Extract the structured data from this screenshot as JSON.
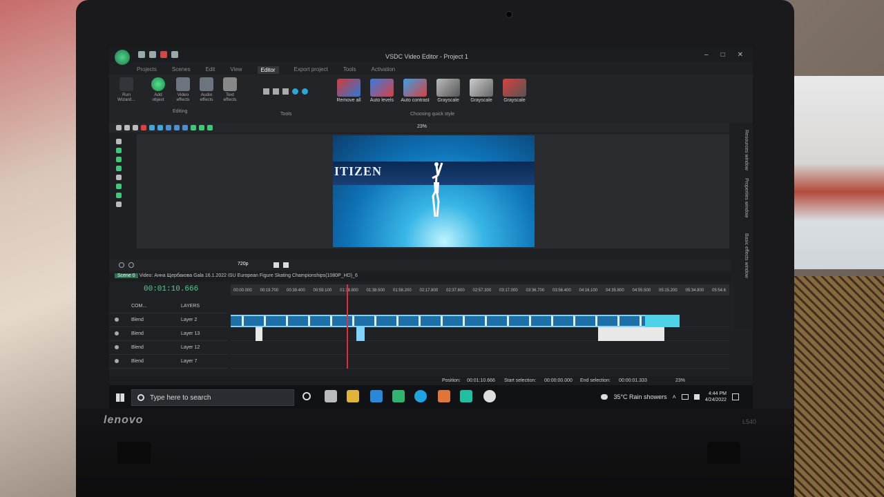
{
  "window": {
    "title": "VSDC Video Editor - Project 1",
    "controls": [
      "–",
      "□",
      "✕"
    ]
  },
  "menu": {
    "items": [
      "Projects",
      "Scenes",
      "Edit",
      "View",
      "Editor",
      "Export project",
      "Tools",
      "Activation"
    ],
    "active": "Editor"
  },
  "ribbon": {
    "groups": [
      {
        "label": "Run Wizard...",
        "icon": "wand-icon"
      },
      {
        "label": "Add object",
        "icon": "add-object-icon"
      },
      {
        "label": "Video effects",
        "icon": "video-effects-icon"
      },
      {
        "label": "Audio effects",
        "icon": "audio-effects-icon"
      },
      {
        "label": "Text effects",
        "icon": "text-effects-icon"
      }
    ],
    "editing_caption": "Editing",
    "tools_caption": "Tools",
    "quick_style_caption": "Choosing quick style",
    "quick_styles": [
      {
        "label": "Remove all",
        "color": "#d23a3a"
      },
      {
        "label": "Auto levels",
        "color": "#3a7be0"
      },
      {
        "label": "Auto contrast",
        "color": "#3aa0e0"
      },
      {
        "label": "Grayscale",
        "color": "#8a8a8a"
      },
      {
        "label": "Grayscale",
        "color": "#9a9a9a"
      },
      {
        "label": "Grayscale",
        "color": "#7a7a7a"
      }
    ]
  },
  "toolbar": {
    "zoom": "23%"
  },
  "preview": {
    "board_text": "ITIZEN"
  },
  "side_tabs": [
    "Resources window",
    "Properties window",
    "Basic effects window"
  ],
  "timeline_toolbar": {
    "resolution": "720p"
  },
  "file_tab": {
    "scene": "Scene 0",
    "title": "Video: Анна Щербакова Gala 16.1.2022 ISU European Figure Skating Championships(1080P_HD)_6"
  },
  "timeline": {
    "current_time": "00:01:10.666",
    "ruler": [
      "00:00.000",
      "00:19.700",
      "00:39.400",
      "00:59.100",
      "01:18.800",
      "01:38.500",
      "01:58.200",
      "02:17.800",
      "02:37.600",
      "02:57.300",
      "03:17.000",
      "03:36.700",
      "03:56.400",
      "04:16.100",
      "04:35.800",
      "04:55.500",
      "05:15.200",
      "05:34.800",
      "05:54.6"
    ],
    "header": {
      "com": "COM...",
      "layers": "LAYERS"
    },
    "tracks": [
      {
        "blend": "Blend",
        "name": "Layer 2"
      },
      {
        "blend": "Blend",
        "name": "Layer 13"
      },
      {
        "blend": "Blend",
        "name": "Layer 12"
      },
      {
        "blend": "Blend",
        "name": "Layer 7"
      }
    ]
  },
  "status": {
    "position_label": "Position:",
    "position": "00:01:10.666",
    "start_label": "Start selection:",
    "start": "00:00:00.000",
    "end_label": "End selection:",
    "end": "00:00:01.333",
    "zoom": "23%"
  },
  "taskbar": {
    "search_placeholder": "Type here to search",
    "weather": "35°C  Rain showers",
    "time": "4:44 PM",
    "date": "4/24/2022"
  },
  "device": {
    "brand": "lenovo",
    "model": "L540"
  }
}
